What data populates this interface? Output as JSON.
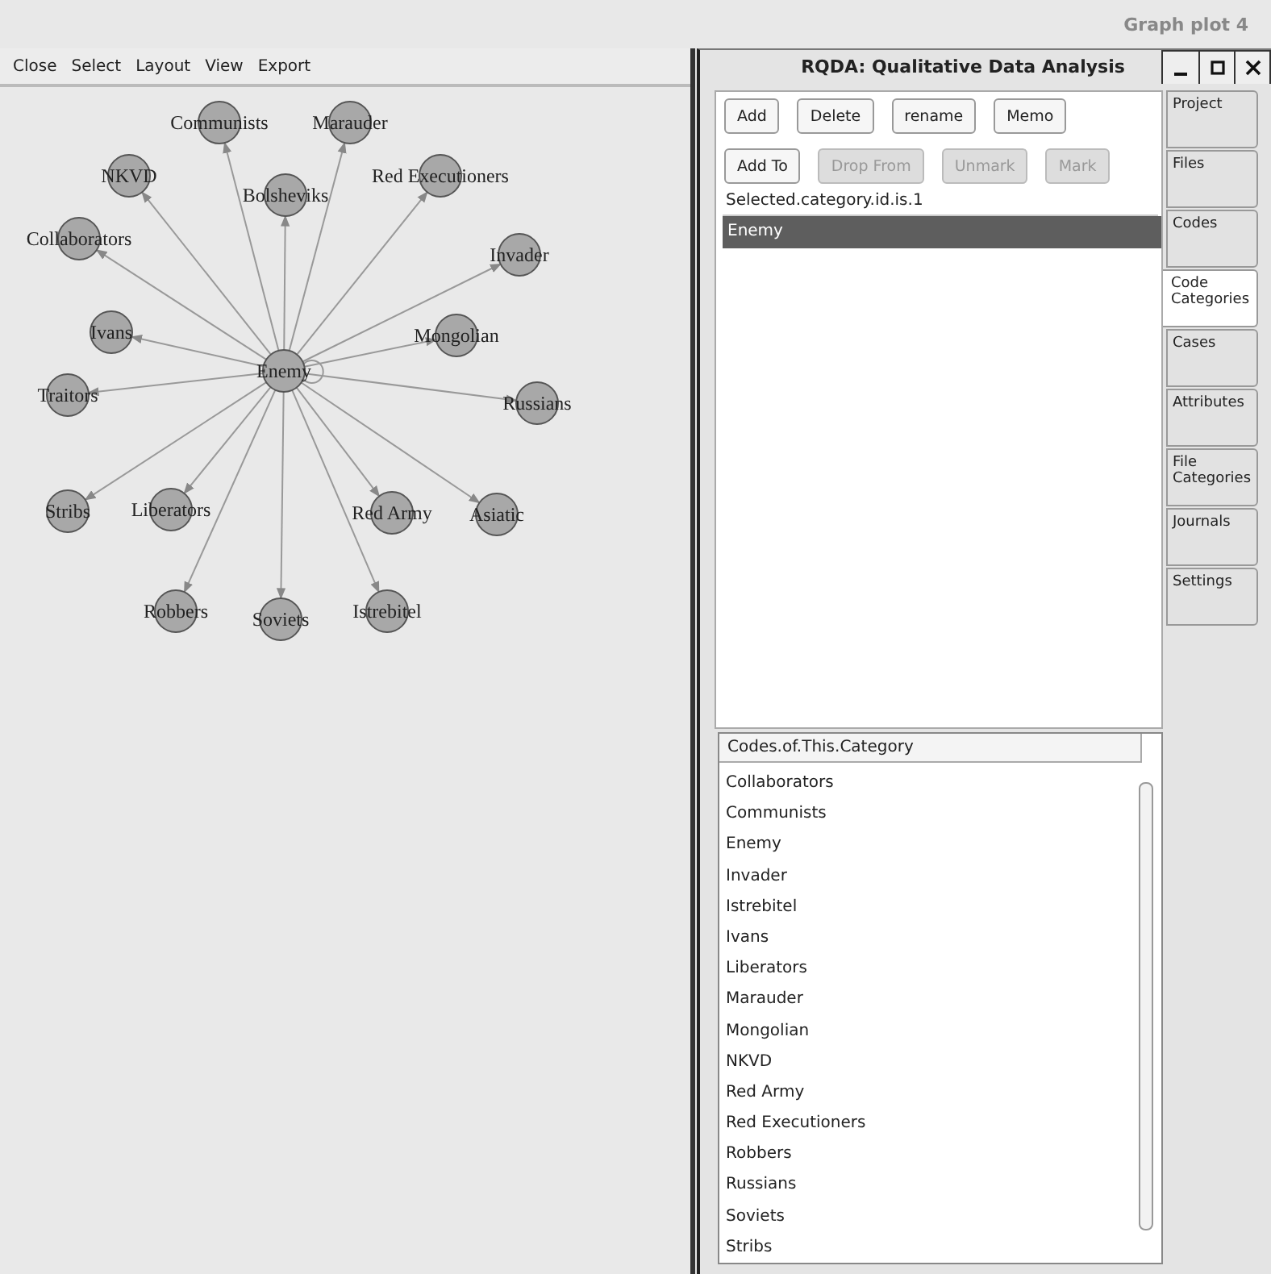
{
  "desktop": {
    "window_label": "Graph plot 4"
  },
  "graph_window": {
    "menu": [
      "Close",
      "Select",
      "Layout",
      "View",
      "Export"
    ],
    "graph": {
      "nodes": [
        {
          "label": "Enemy",
          "kind": "hub",
          "self_loop": true
        },
        {
          "label": "Communists",
          "kind": "leaf"
        },
        {
          "label": "Marauder",
          "kind": "leaf"
        },
        {
          "label": "NKVD",
          "kind": "leaf"
        },
        {
          "label": "Bolsheviks",
          "kind": "leaf"
        },
        {
          "label": "Red Executioners",
          "kind": "leaf"
        },
        {
          "label": "Collaborators",
          "kind": "leaf"
        },
        {
          "label": "Invader",
          "kind": "leaf"
        },
        {
          "label": "Ivans",
          "kind": "leaf"
        },
        {
          "label": "Mongolian",
          "kind": "leaf"
        },
        {
          "label": "Traitors",
          "kind": "leaf"
        },
        {
          "label": "Russians",
          "kind": "leaf"
        },
        {
          "label": "Stribs",
          "kind": "leaf"
        },
        {
          "label": "Liberators",
          "kind": "leaf"
        },
        {
          "label": "Red Army",
          "kind": "leaf"
        },
        {
          "label": "Asiatic",
          "kind": "leaf"
        },
        {
          "label": "Robbers",
          "kind": "leaf"
        },
        {
          "label": "Soviets",
          "kind": "leaf"
        },
        {
          "label": "Istrebitel",
          "kind": "leaf"
        }
      ]
    }
  },
  "window": {
    "title": "RQDA: Qualitative Data Analysis",
    "button_rows": [
      [
        {
          "label": "Add",
          "disabled": false
        },
        {
          "label": "Delete",
          "disabled": false
        },
        {
          "label": "rename",
          "disabled": false
        },
        {
          "label": "Memo",
          "disabled": false
        }
      ],
      [
        {
          "label": "Add To",
          "disabled": false
        },
        {
          "label": "Drop From",
          "disabled": true
        },
        {
          "label": "Unmark",
          "disabled": true
        },
        {
          "label": "Mark",
          "disabled": true
        }
      ]
    ],
    "categories": {
      "header": "Selected.category.id.is.1",
      "rows": [
        {
          "label": "Enemy",
          "selected": true
        }
      ]
    },
    "codes": {
      "header": "Codes.of.This.Category",
      "rows": [
        {
          "label": "Collaborators",
          "selected": false
        },
        {
          "label": "Communists",
          "selected": false
        },
        {
          "label": "Enemy",
          "selected": false
        },
        {
          "label": "Invader",
          "selected": false
        },
        {
          "label": "Istrebitel",
          "selected": false
        },
        {
          "label": "Ivans",
          "selected": false
        },
        {
          "label": "Liberators",
          "selected": false
        },
        {
          "label": "Marauder",
          "selected": false
        },
        {
          "label": "Mongolian",
          "selected": false
        },
        {
          "label": "NKVD",
          "selected": false
        },
        {
          "label": "Red Army",
          "selected": false
        },
        {
          "label": "Red Executioners",
          "selected": false
        },
        {
          "label": "Robbers",
          "selected": false
        },
        {
          "label": "Russians",
          "selected": false
        },
        {
          "label": "Soviets",
          "selected": false
        },
        {
          "label": "Stribs",
          "selected": false
        }
      ]
    },
    "tabs": [
      {
        "label": "Project",
        "selected": false
      },
      {
        "label": "Files",
        "selected": false
      },
      {
        "label": "Codes",
        "selected": false
      },
      {
        "label": "Code\nCategories",
        "selected": true
      },
      {
        "label": "Cases",
        "selected": false
      },
      {
        "label": "Attributes",
        "selected": false
      },
      {
        "label": "File\nCategories",
        "selected": false
      },
      {
        "label": "Journals",
        "selected": false
      },
      {
        "label": "Settings",
        "selected": false
      }
    ]
  }
}
